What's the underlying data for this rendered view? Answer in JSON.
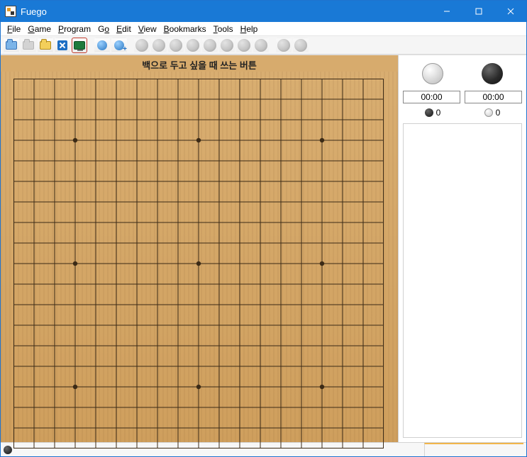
{
  "window": {
    "title": "Fuego"
  },
  "menu": {
    "file": "File",
    "game": "Game",
    "program": "Program",
    "go": "Go",
    "edit": "Edit",
    "view": "View",
    "bookmarks": "Bookmarks",
    "tools": "Tools",
    "help": "Help"
  },
  "toolbar": {
    "icons": {
      "new_file": "new-file-icon",
      "save": "save-icon",
      "open": "open-folder-icon",
      "close": "close-doc-icon",
      "engine": "engine-icon",
      "network": "network-icon",
      "network_add": "network-add-icon"
    }
  },
  "board": {
    "caption": "백으로 두고 싶을 때 쓰는 버튼",
    "size": 19,
    "star_points": [
      [
        3,
        3
      ],
      [
        9,
        3
      ],
      [
        15,
        3
      ],
      [
        3,
        9
      ],
      [
        9,
        9
      ],
      [
        15,
        9
      ],
      [
        3,
        15
      ],
      [
        9,
        15
      ],
      [
        15,
        15
      ]
    ]
  },
  "sidebar": {
    "clock_white": "00:00",
    "clock_black": "00:00",
    "captures_black": "0",
    "captures_white": "0"
  },
  "status": {
    "turn": "black"
  }
}
